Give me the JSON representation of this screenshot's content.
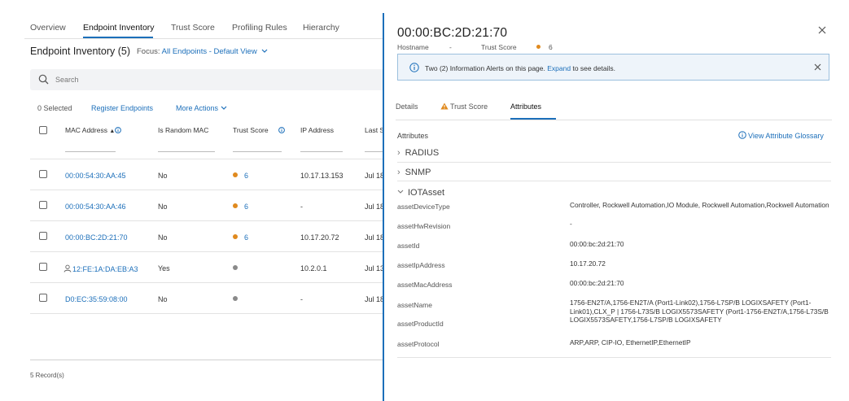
{
  "tabs": [
    "Overview",
    "Endpoint Inventory",
    "Trust Score",
    "Profiling Rules",
    "Hierarchy"
  ],
  "inventory": {
    "title": "Endpoint Inventory (5)",
    "focus_label": "Focus:",
    "focus_value": "All Endpoints - Default View"
  },
  "search": {
    "placeholder": "Search"
  },
  "actions": {
    "selected": "0 Selected",
    "register": "Register Endpoints",
    "more": "More Actions"
  },
  "table": {
    "headers": [
      "MAC Address",
      "Is Random MAC",
      "Trust Score",
      "IP Address",
      "Last S"
    ],
    "rows": [
      {
        "mac": "00:00:54:30:AA:45",
        "random": "No",
        "score": "6",
        "ip": "10.17.13.153",
        "last": "Jul 18"
      },
      {
        "mac": "00:00:54:30:AA:46",
        "random": "No",
        "score": "6",
        "ip": "-",
        "last": "Jul 18"
      },
      {
        "mac": "00:00:BC:2D:21:70",
        "random": "No",
        "score": "6",
        "ip": "10.17.20.72",
        "last": "Jul 18"
      },
      {
        "mac": "12:FE:1A:DA:EB:A3",
        "random": "Yes",
        "score": "",
        "ip": "10.2.0.1",
        "last": "Jul 13"
      },
      {
        "mac": "D0:EC:35:59:08:00",
        "random": "No",
        "score": "",
        "ip": "-",
        "last": "Jul 18"
      }
    ]
  },
  "records": "5 Record(s)",
  "drawer": {
    "title": "00:00:BC:2D:21:70",
    "hostname_label": "Hostname",
    "hostname_value": "-",
    "trust_label": "Trust Score",
    "trust_value": "6",
    "alert_text": "Two (2) Information Alerts on this page.",
    "alert_link": "Expand",
    "alert_suffix": "to see details.",
    "tabs": [
      "Details",
      "Trust Score",
      "Attributes"
    ],
    "attributes_header": "Attributes",
    "glossary": "View Attribute Glossary",
    "sections": [
      "RADIUS",
      "SNMP",
      "IOTAsset"
    ],
    "attributes": [
      {
        "key": "assetDeviceType",
        "value": "Controller, Rockwell Automation,IO Module, Rockwell Automation,Rockwell Automation"
      },
      {
        "key": "assetHwRevision",
        "value": "-"
      },
      {
        "key": "assetId",
        "value": "00:00:bc:2d:21:70"
      },
      {
        "key": "assetIpAddress",
        "value": "10.17.20.72"
      },
      {
        "key": "assetMacAddress",
        "value": "00:00:bc:2d:21:70"
      },
      {
        "key": "assetName",
        "value": "1756-EN2T/A,1756-EN2T/A (Port1-Link02),1756-L7SP/B LOGIXSAFETY (Port1-Link01),CLX_P | 1756-L73S/B LOGIX5573SAFETY (Port1-1756-EN2T/A,1756-L73S/B LOGIX5573SAFETY,1756-L7SP/B LOGIXSAFETY"
      },
      {
        "key": "assetProductId",
        "value": ""
      },
      {
        "key": "assetProtocol",
        "value": "ARP,ARP, CIP-IO, EthernetIP,EthernetIP"
      }
    ]
  },
  "colors": {
    "accent": "#1c6fba",
    "warning": "#e08a1e",
    "neutral_dot": "#8a8a8a",
    "alert_bg": "#eef4fa"
  }
}
